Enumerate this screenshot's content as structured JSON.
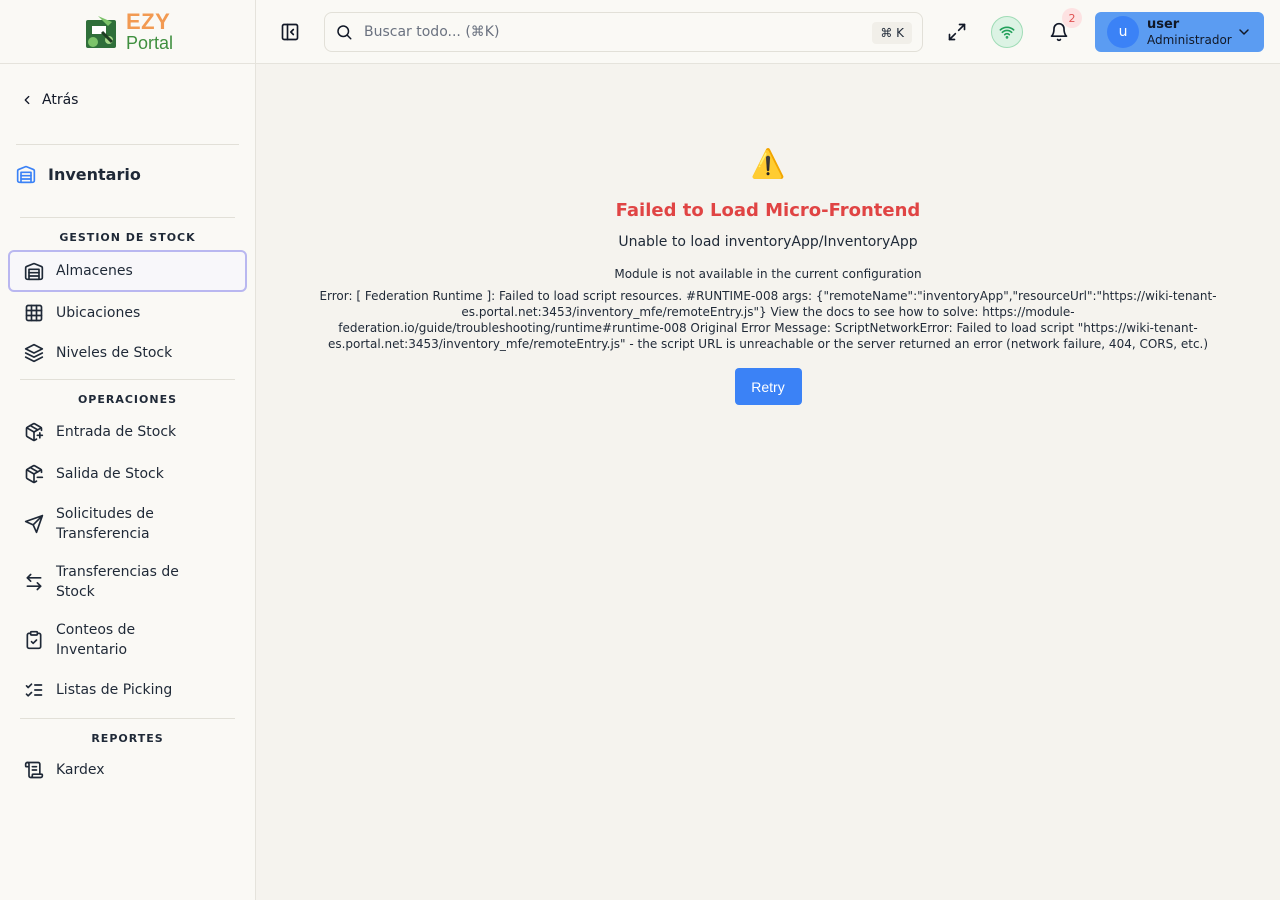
{
  "brand": {
    "line1": "EZY",
    "line2": "Portal"
  },
  "sidebar": {
    "back_label": "Atrás",
    "module_title": "Inventario",
    "sections": [
      {
        "title": "GESTION DE STOCK"
      },
      {
        "title": "OPERACIONES"
      },
      {
        "title": "REPORTES"
      }
    ],
    "items": [
      {
        "label": "Almacenes",
        "icon": "warehouse-icon",
        "active": true
      },
      {
        "label": "Ubicaciones",
        "icon": "grid-icon"
      },
      {
        "label": "Niveles de Stock",
        "icon": "layers-icon"
      },
      {
        "label": "Entrada de Stock",
        "icon": "package-plus-icon"
      },
      {
        "label": "Salida de Stock",
        "icon": "package-minus-icon"
      },
      {
        "label": "Solicitudes de Transferencia",
        "icon": "send-icon"
      },
      {
        "label": "Transferencias de Stock",
        "icon": "arrows-left-right-icon"
      },
      {
        "label": "Conteos de Inventario",
        "icon": "clipboard-check-icon"
      },
      {
        "label": "Listas de Picking",
        "icon": "list-checks-icon"
      },
      {
        "label": "Kardex",
        "icon": "scroll-icon"
      }
    ]
  },
  "header": {
    "search_placeholder": "Buscar todo... (⌘K)",
    "shortcut": "⌘ K",
    "notifications_count": "2",
    "user": {
      "initial": "u",
      "name": "user",
      "role": "Administrador"
    }
  },
  "main": {
    "warning_glyph": "⚠️",
    "title": "Failed to Load Micro-Frontend",
    "subtitle": "Unable to load inventoryApp/InventoryApp",
    "module_message": "Module is not available in the current configuration",
    "error_message": "Error: [ Federation Runtime ]: Failed to load script resources. #RUNTIME-008 args: {\"remoteName\":\"inventoryApp\",\"resourceUrl\":\"https://wiki-tenant-es.portal.net:3453/inventory_mfe/remoteEntry.js\"} View the docs to see how to solve: https://module-federation.io/guide/troubleshooting/runtime#runtime-008 Original Error Message: ScriptNetworkError: Failed to load script \"https://wiki-tenant-es.portal.net:3453/inventory_mfe/remoteEntry.js\" - the script URL is unreachable or the server returned an error (network failure, 404, CORS, etc.)",
    "retry_label": "Retry"
  },
  "colors": {
    "accent": "#3b82f6",
    "error": "#e04444",
    "user_bg": "#5b9cf2"
  }
}
